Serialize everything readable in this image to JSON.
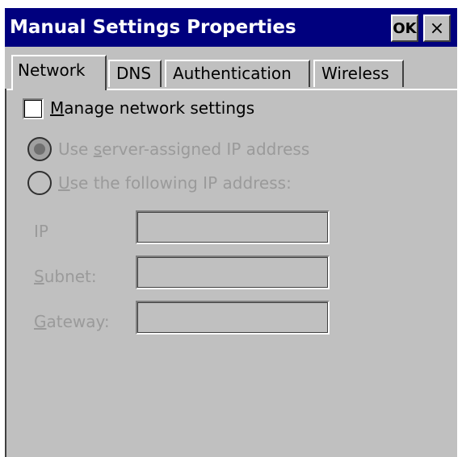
{
  "window": {
    "title": "Manual Settings Properties",
    "ok_label": "OK",
    "close_label": "×"
  },
  "tabs": [
    {
      "label": "Network",
      "active": true
    },
    {
      "label": "DNS",
      "active": false
    },
    {
      "label": "Authentication",
      "active": false
    },
    {
      "label": "Wireless",
      "active": false
    }
  ],
  "network": {
    "manage_checkbox": {
      "label_first": "M",
      "label_rest": "anage network settings",
      "checked": false
    },
    "radio_server": {
      "label_pre": "Use ",
      "label_ul": "s",
      "label_post": "erver-assigned IP address",
      "selected": true,
      "enabled": false
    },
    "radio_following": {
      "label_ul": "U",
      "label_post": "se the following IP address:",
      "selected": false,
      "enabled": false
    },
    "fields": {
      "ip": {
        "label": "IP",
        "value": ""
      },
      "subnet": {
        "label_ul": "S",
        "label_rest": "ubnet:",
        "value": ""
      },
      "gateway": {
        "label_ul": "G",
        "label_rest": "ateway:",
        "value": ""
      }
    }
  },
  "colors": {
    "titlebar": "#00007e",
    "face": "#c0c0c0",
    "disabled_text": "#9a9a9a"
  }
}
